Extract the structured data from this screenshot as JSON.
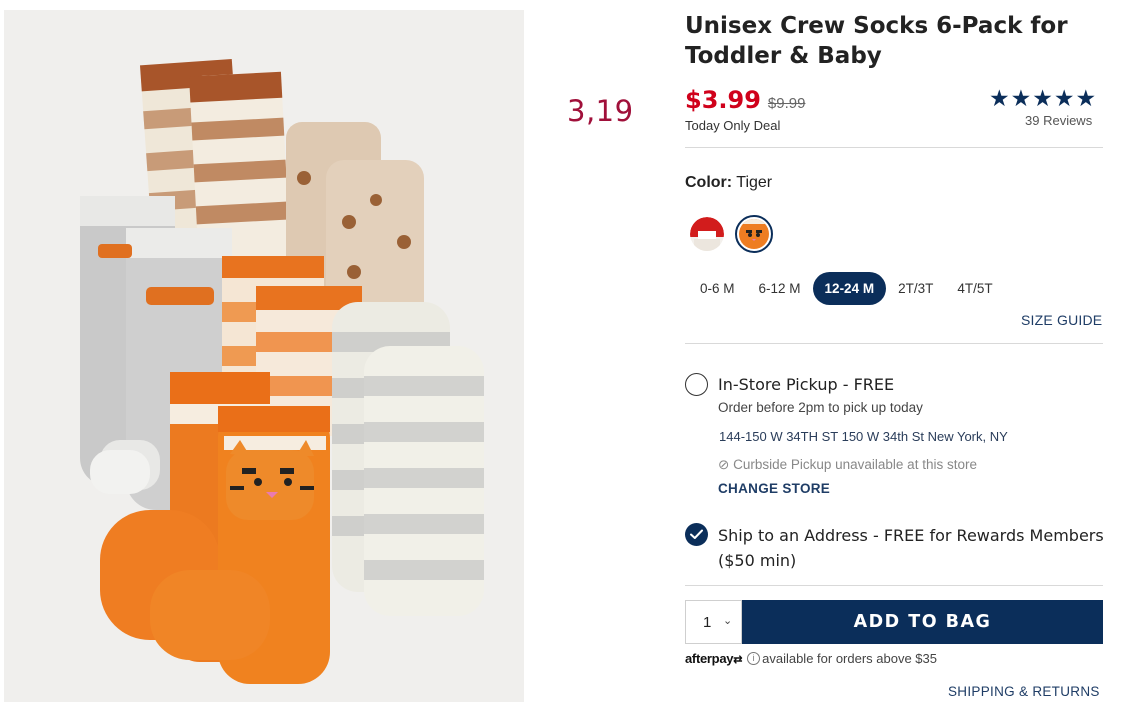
{
  "annotation": "3,19",
  "product": {
    "title": "Unisex Crew Socks 6-Pack for Toddler & Baby",
    "price_sale": "$3.99",
    "price_original": "$9.99",
    "deal_label": "Today Only Deal",
    "rating_stars": 5,
    "reviews_label": "39 Reviews"
  },
  "color": {
    "label": "Color:",
    "value": "Tiger",
    "swatches": [
      "red-white-swatch",
      "tiger-swatch"
    ],
    "selected": "Tiger"
  },
  "sizes": {
    "options": [
      "0-6 M",
      "6-12 M",
      "12-24 M",
      "2T/3T",
      "4T/5T"
    ],
    "selected": "12-24 M",
    "guide_label": "SIZE GUIDE"
  },
  "pickup": {
    "title": "In-Store Pickup - FREE",
    "subtitle": "Order before 2pm to pick up today",
    "store_address": "144-150 W 34TH ST 150 W 34th St New York, NY",
    "curbside": "Curbside Pickup unavailable at this store",
    "change_store": "CHANGE STORE"
  },
  "shipping": {
    "title": "Ship to an Address - FREE for Rewards Members ($50 min)"
  },
  "cart": {
    "quantity": "1",
    "add_label": "ADD TO BAG"
  },
  "afterpay": {
    "logo": "afterpay",
    "text": "available for orders above $35"
  },
  "links": {
    "shipping_returns": "SHIPPING & RETURNS"
  },
  "colors": {
    "navy": "#0b2e5a",
    "sale_red": "#d0011b",
    "annotation": "#a0103a"
  }
}
